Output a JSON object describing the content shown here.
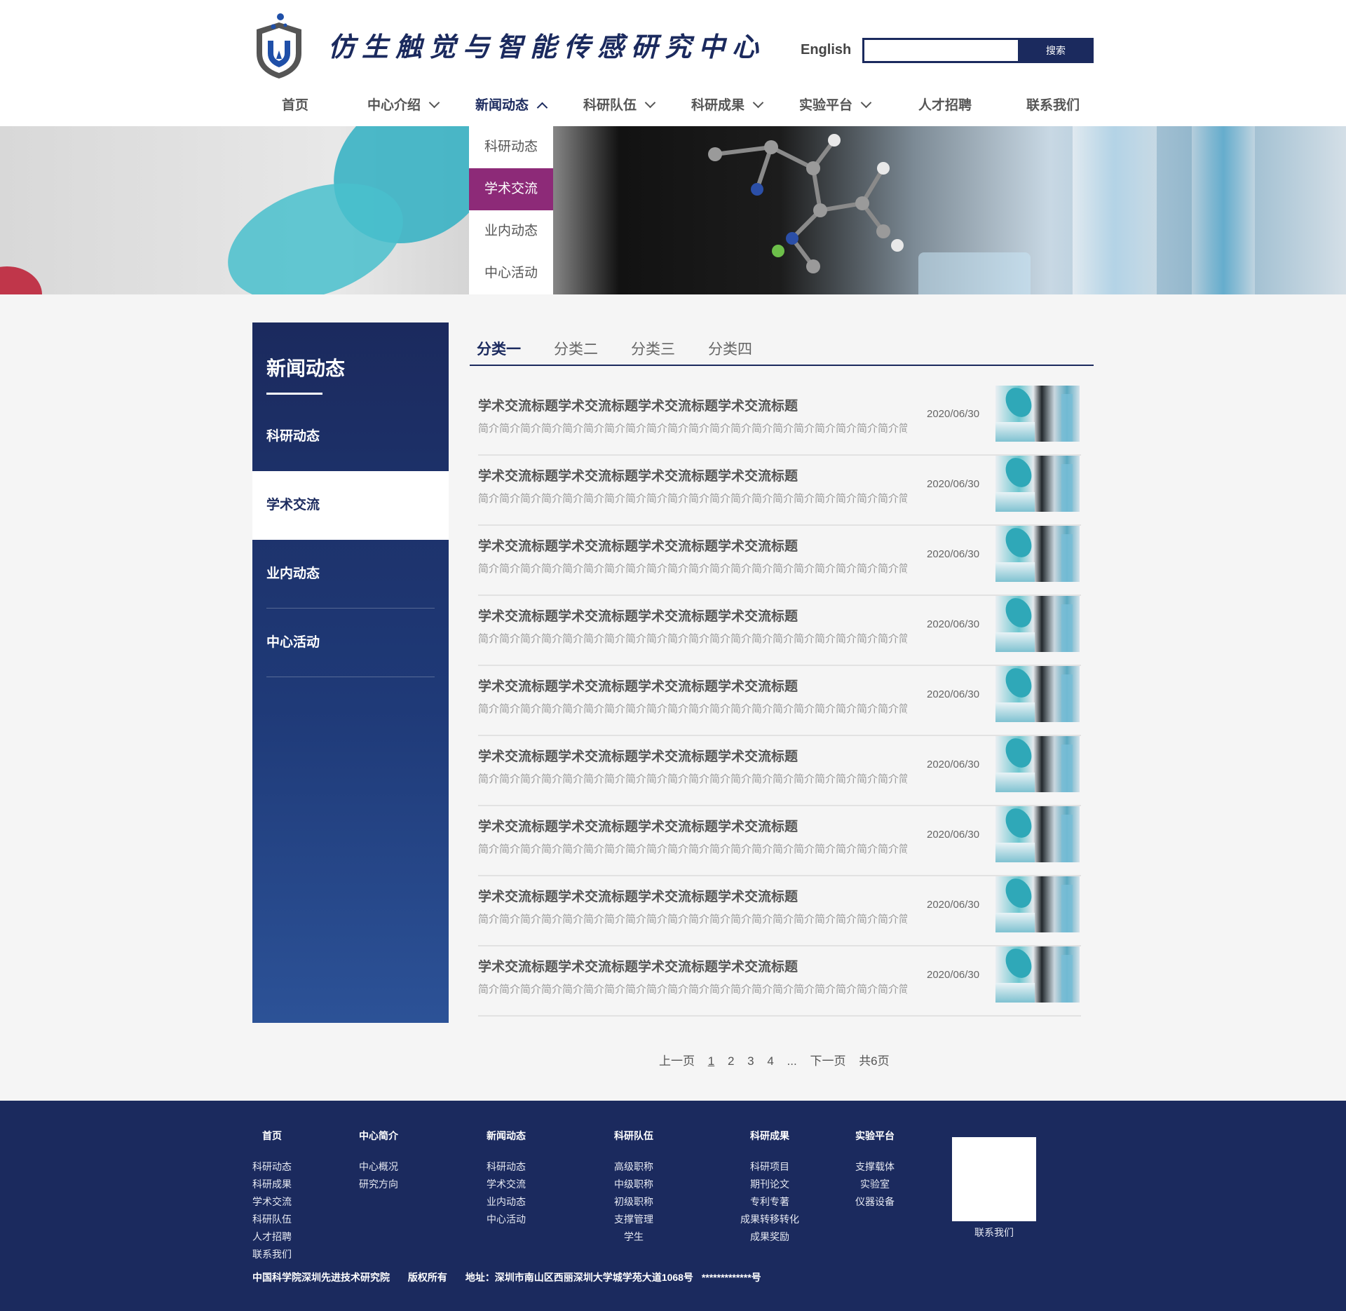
{
  "header": {
    "site_title": "仿生触觉与智能传感研究中心",
    "lang_link": "English",
    "search": {
      "placeholder": "",
      "button": "搜索"
    }
  },
  "nav": {
    "items": [
      {
        "label": "首页",
        "has_dropdown": false
      },
      {
        "label": "中心介绍",
        "has_dropdown": true
      },
      {
        "label": "新闻动态",
        "has_dropdown": true,
        "active": true
      },
      {
        "label": "科研队伍",
        "has_dropdown": true
      },
      {
        "label": "科研成果",
        "has_dropdown": true
      },
      {
        "label": "实验平台",
        "has_dropdown": true
      },
      {
        "label": "人才招聘",
        "has_dropdown": false
      },
      {
        "label": "联系我们",
        "has_dropdown": false
      }
    ],
    "dropdown": [
      "科研动态",
      "学术交流",
      "业内动态",
      "中心活动"
    ],
    "dropdown_active": "学术交流"
  },
  "sidebar": {
    "title": "新闻动态",
    "items": [
      "科研动态",
      "学术交流",
      "业内动态",
      "中心活动"
    ],
    "active": "学术交流"
  },
  "tabs": {
    "items": [
      "分类一",
      "分类二",
      "分类三",
      "分类四"
    ],
    "active": "分类一"
  },
  "list": [
    {
      "title": "学术交流标题学术交流标题学术交流标题学术交流标题",
      "intro": "简介简介简介简介简介简介简介简介简介简介简介简介简介简介简介简介简介简介简介简介简介简介简介简介",
      "date": "2020/06/30"
    },
    {
      "title": "学术交流标题学术交流标题学术交流标题学术交流标题",
      "intro": "简介简介简介简介简介简介简介简介简介简介简介简介简介简介简介简介简介简介简介简介简介简介简介简介",
      "date": "2020/06/30"
    },
    {
      "title": "学术交流标题学术交流标题学术交流标题学术交流标题",
      "intro": "简介简介简介简介简介简介简介简介简介简介简介简介简介简介简介简介简介简介简介简介简介简介简介简介",
      "date": "2020/06/30"
    },
    {
      "title": "学术交流标题学术交流标题学术交流标题学术交流标题",
      "intro": "简介简介简介简介简介简介简介简介简介简介简介简介简介简介简介简介简介简介简介简介简介简介简介简介",
      "date": "2020/06/30"
    },
    {
      "title": "学术交流标题学术交流标题学术交流标题学术交流标题",
      "intro": "简介简介简介简介简介简介简介简介简介简介简介简介简介简介简介简介简介简介简介简介简介简介简介简介",
      "date": "2020/06/30"
    },
    {
      "title": "学术交流标题学术交流标题学术交流标题学术交流标题",
      "intro": "简介简介简介简介简介简介简介简介简介简介简介简介简介简介简介简介简介简介简介简介简介简介简介简介",
      "date": "2020/06/30"
    },
    {
      "title": "学术交流标题学术交流标题学术交流标题学术交流标题",
      "intro": "简介简介简介简介简介简介简介简介简介简介简介简介简介简介简介简介简介简介简介简介简介简介简介简介",
      "date": "2020/06/30"
    },
    {
      "title": "学术交流标题学术交流标题学术交流标题学术交流标题",
      "intro": "简介简介简介简介简介简介简介简介简介简介简介简介简介简介简介简介简介简介简介简介简介简介简介简介",
      "date": "2020/06/30"
    },
    {
      "title": "学术交流标题学术交流标题学术交流标题学术交流标题",
      "intro": "简介简介简介简介简介简介简介简介简介简介简介简介简介简介简介简介简介简介简介简介简介简介简介简介",
      "date": "2020/06/30"
    }
  ],
  "pagination": {
    "prev": "上一页",
    "pages": [
      "1",
      "2",
      "3",
      "4"
    ],
    "current": "1",
    "ellipsis": "...",
    "next": "下一页",
    "total": "共6页"
  },
  "footer": {
    "columns": [
      {
        "head": "首页",
        "links": [
          "科研动态",
          "科研成果",
          "学术交流",
          "科研队伍",
          "人才招聘",
          "联系我们"
        ]
      },
      {
        "head": "中心简介",
        "links": [
          "中心概况",
          "研究方向"
        ]
      },
      {
        "head": "新闻动态",
        "links": [
          "科研动态",
          "学术交流",
          "业内动态",
          "中心活动"
        ]
      },
      {
        "head": "科研队伍",
        "links": [
          "高级职称",
          "中级职称",
          "初级职称",
          "支撑管理",
          "学生"
        ]
      },
      {
        "head": "科研成果",
        "links": [
          "科研项目",
          "期刊论文",
          "专利专著",
          "成果转移转化",
          "成果奖励"
        ]
      },
      {
        "head": "实验平台",
        "links": [
          "支撑载体",
          "实验室",
          "仪器设备"
        ]
      }
    ],
    "qr_label": "联系我们",
    "copyright": {
      "org": "中国科学院深圳先进技术研究院",
      "rights": "版权所有",
      "address": "地址：深圳市南山区西丽深圳大学城学苑大道1068号",
      "icp": "*************号"
    }
  },
  "colors": {
    "primary": "#1b2a5e",
    "dropdown_active": "#8d2a78",
    "background": "#f5f5f5"
  },
  "icons": [
    "logo-shield-icon",
    "chevron-down-icon",
    "chevron-up-icon"
  ]
}
